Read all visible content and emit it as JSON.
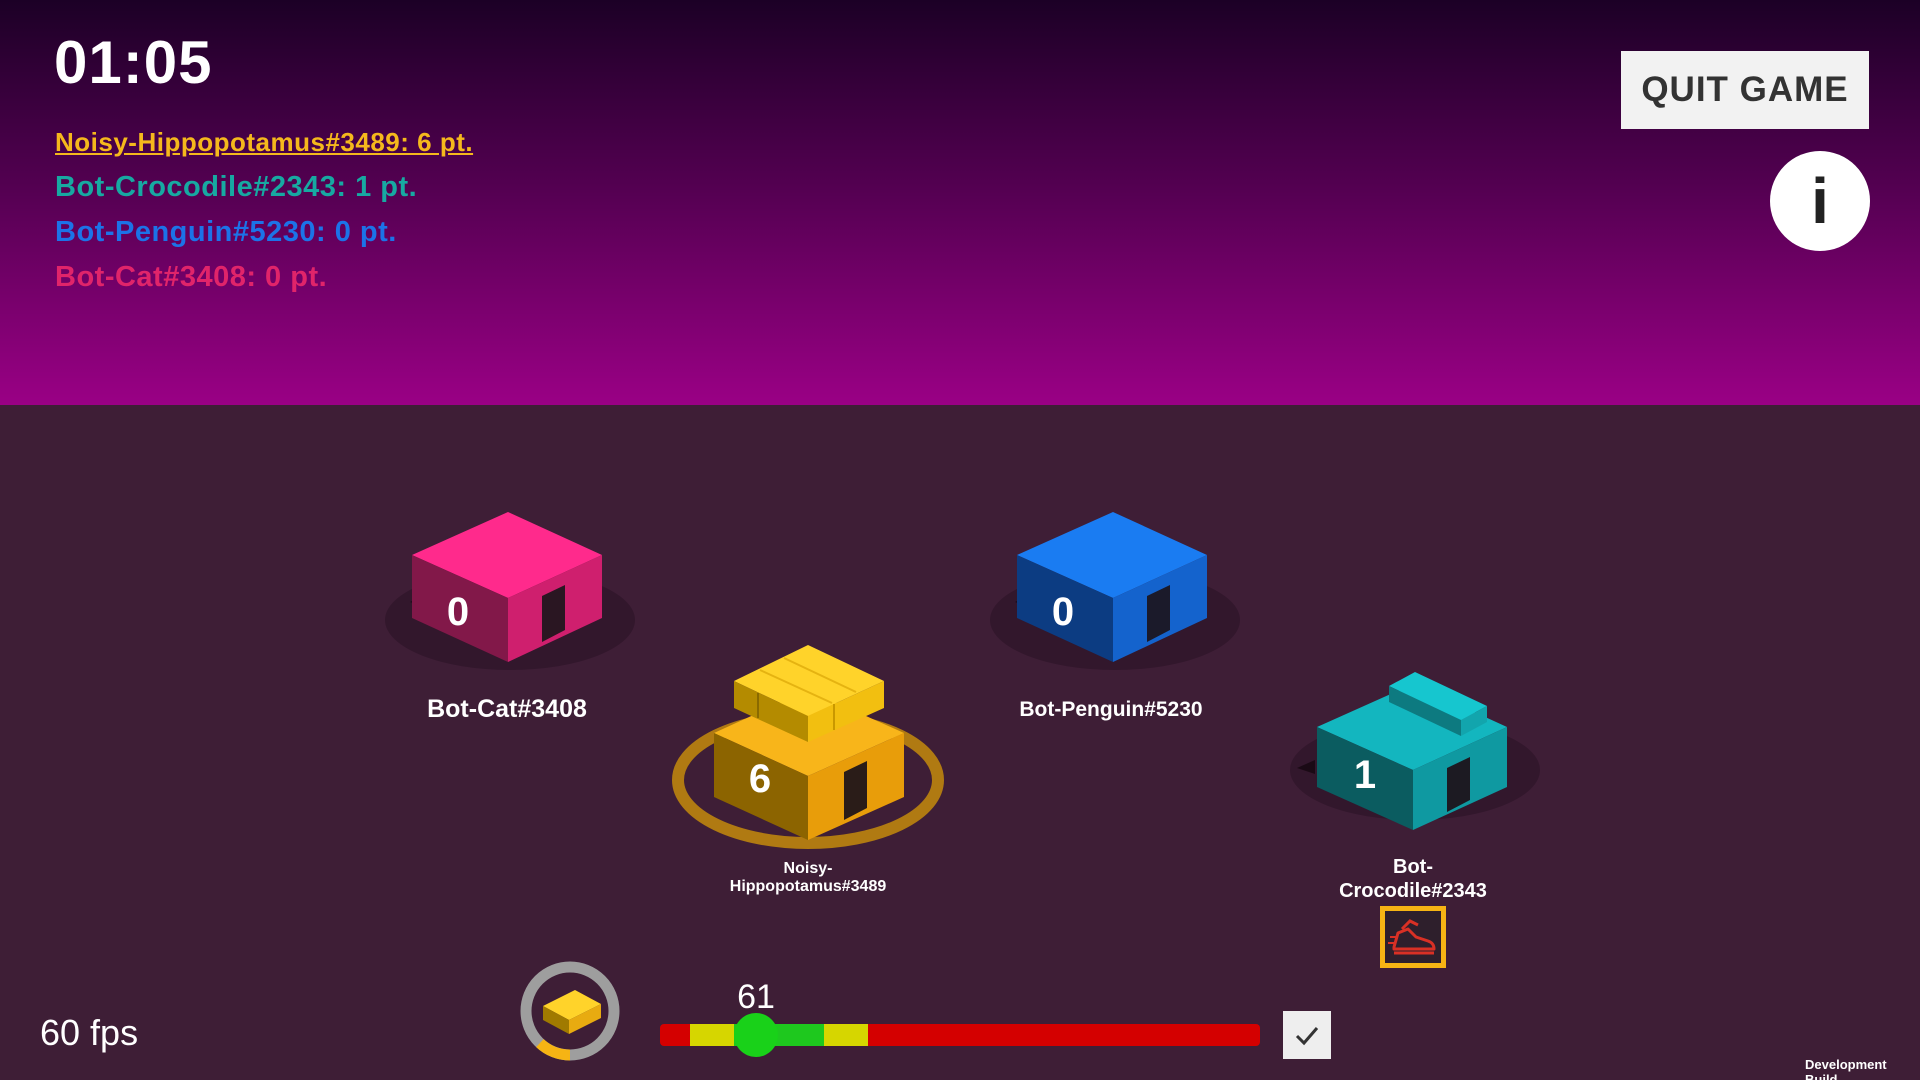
{
  "hud": {
    "timer": "01:05",
    "quit_label": "QUIT GAME",
    "info_label": "i",
    "fps": "60 fps",
    "dev_build": "Development Build"
  },
  "scoreboard": [
    {
      "text": "Noisy-Hippopotamus#3489: 6 pt.",
      "color": "#f5b81c",
      "active": true
    },
    {
      "text": "Bot-Crocodile#2343: 1 pt.",
      "color": "#17a9a2",
      "active": false
    },
    {
      "text": "Bot-Penguin#5230: 0 pt.",
      "color": "#1c73e8",
      "active": false
    },
    {
      "text": "Bot-Cat#3408: 0 pt.",
      "color": "#e0246a",
      "active": false
    }
  ],
  "houses": {
    "cat": {
      "label": "Bot-Cat#3408",
      "count": "0",
      "color": "#ff2a8c"
    },
    "penguin": {
      "label": "Bot-Penguin#5230",
      "count": "0",
      "color": "#1a7cf2"
    },
    "hippo": {
      "label_line1": "Noisy-",
      "label_line2": "Hippopotamus#3489",
      "count": "6",
      "color": "#f8b51a"
    },
    "crocodile": {
      "label_line1": "Bot-",
      "label_line2": "Crocodile#2343",
      "count": "1",
      "color": "#13b6bf"
    }
  },
  "slider": {
    "value_label": "61",
    "value_fraction": 0.16
  },
  "powerup": {
    "icon": "speed-shoe-icon",
    "color": "#d93025"
  },
  "inventory": {
    "icon": "brick-icon",
    "fill_fraction": 0.12
  }
}
